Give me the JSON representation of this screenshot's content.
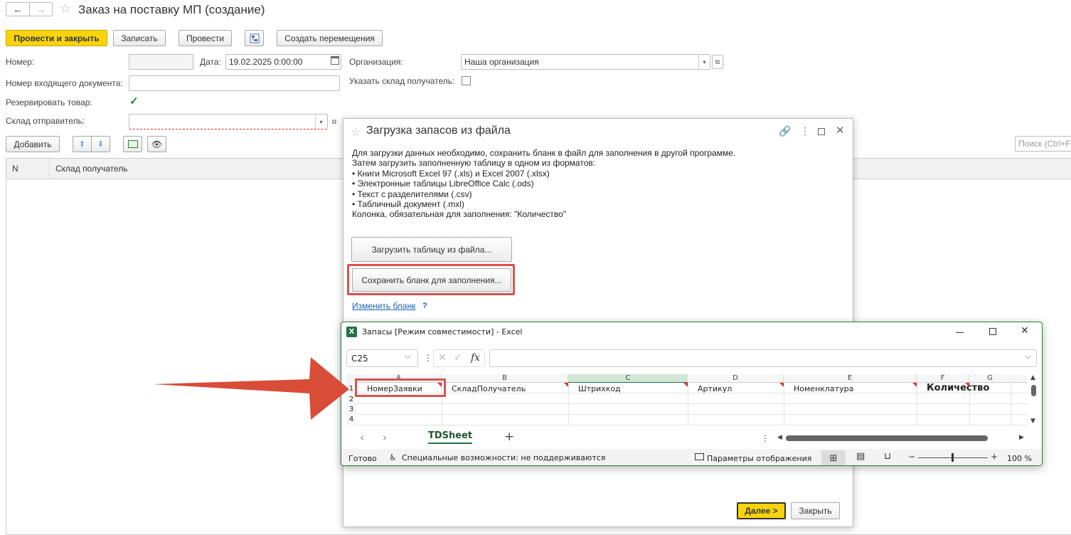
{
  "nav": {
    "back": "←",
    "forward": "→",
    "star": "☆",
    "title": "Заказ на поставку МП (создание)"
  },
  "toolbar": {
    "post_close": "Провести и закрыть",
    "save": "Записать",
    "post": "Провести",
    "create_move": "Создать перемещения"
  },
  "form": {
    "number_label": "Номер:",
    "number_value": "",
    "date_label": "Дата:",
    "date_value": "19.02.2025  0:00:00",
    "org_label": "Организация:",
    "org_value": "Наша организация",
    "incoming_label": "Номер входящего документа:",
    "incoming_value": "",
    "specify_wh_label": "Указать склад получатель:",
    "reserve_label": "Резервировать товар:",
    "sender_wh_label": "Склад отправитель:",
    "sender_wh_value": ""
  },
  "table": {
    "add_button": "Добавить",
    "search_placeholder": "Поиск (Ctrl+F)",
    "col_n": "N",
    "col_wh": "Склад получатель"
  },
  "dialog": {
    "title": "Загрузка запасов из файла",
    "lines": [
      "Для загрузки данных необходимо, сохранить бланк в файл для заполнения в другой программе.",
      "Затем загрузить заполненную таблицу в одном из форматов:",
      "• Книги Microsoft Excel 97 (.xls) и Excel 2007 (.xlsx)",
      "• Электронные таблицы LibreOffice Calc (.ods)",
      "• Текст с разделителями (.csv)",
      "• Табличный документ (.mxl)",
      "Колонка, обязательная для заполнения: \"Количество\""
    ],
    "load_button": "Загрузить таблицу из файла...",
    "save_template_button": "Сохранить бланк для заполнения...",
    "change_template_link": "Изменить бланк",
    "help": "?",
    "next_button": "Далее >",
    "close_button": "Закрыть"
  },
  "excel": {
    "title": "Запасы  [Режим совместимости] - Excel",
    "cell_ref": "C25",
    "fx": "fx",
    "columns": [
      "A",
      "B",
      "C",
      "D",
      "E",
      "F",
      "G"
    ],
    "rows": [
      "1",
      "2",
      "3",
      "4"
    ],
    "headers": [
      "НомерЗаявки",
      "СкладПолучатель",
      "Штрихкод",
      "Артикул",
      "Номенклатура",
      "Количество"
    ],
    "sheet_tab": "TDSheet",
    "status_ready": "Готово",
    "accessibility": "Специальные возможности: не поддерживаются",
    "display_settings": "Параметры отображения",
    "zoom": "100 %"
  },
  "colors": {
    "accent_yellow": "#f8d40e",
    "highlight_red": "#d9534f",
    "excel_green": "#217346",
    "link_blue": "#1a5fb4"
  }
}
